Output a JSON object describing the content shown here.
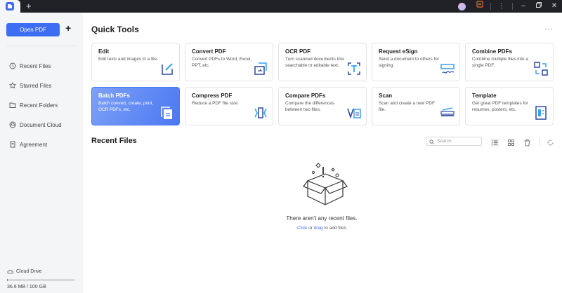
{
  "titlebar": {
    "new_tab": "+",
    "icons": [
      "avatar",
      "gift-icon",
      "more-vertical-icon",
      "minimize-icon",
      "restore-icon",
      "close-icon"
    ]
  },
  "sidebar": {
    "open_pdf": "Open PDF",
    "add": "+",
    "items": [
      {
        "label": "Recent Files",
        "icon": "clock-icon"
      },
      {
        "label": "Starred Files",
        "icon": "star-icon"
      },
      {
        "label": "Recent Folders",
        "icon": "folder-icon"
      },
      {
        "label": "Document Cloud",
        "icon": "cloud-icon"
      },
      {
        "label": "Agreement",
        "icon": "document-icon"
      }
    ],
    "cloud_drive": "Cloud Drive",
    "storage": "36.6 MB / 100 GB",
    "storage_fraction": 0.0004
  },
  "quick_tools": {
    "title": "Quick Tools",
    "more": "...",
    "cards": [
      {
        "title": "Edit",
        "desc": "Edit texts and images in a file.",
        "icon": "edit-icon"
      },
      {
        "title": "Convert PDF",
        "desc": "Convert PDFs to Word, Excel, PPT, etc.",
        "icon": "convert-icon"
      },
      {
        "title": "OCR PDF",
        "desc": "Turn scanned documents into searchable or editable text.",
        "icon": "ocr-icon"
      },
      {
        "title": "Request eSign",
        "desc": "Send a document to others for signing.",
        "icon": "esign-icon"
      },
      {
        "title": "Combine PDFs",
        "desc": "Combine multiple files into a single PDF.",
        "icon": "combine-icon"
      },
      {
        "title": "Batch PDFs",
        "desc": "Batch convert, create, print, OCR PDFs, etc.",
        "icon": "batch-icon"
      },
      {
        "title": "Compress PDF",
        "desc": "Reduce a PDF file size.",
        "icon": "compress-icon"
      },
      {
        "title": "Compare PDFs",
        "desc": "Compare the differences between two files.",
        "icon": "compare-icon"
      },
      {
        "title": "Scan",
        "desc": "Scan and create a new PDF file.",
        "icon": "scan-icon"
      },
      {
        "title": "Template",
        "desc": "Get great PDF templates for resumes, posters, etc.",
        "icon": "template-icon"
      }
    ]
  },
  "recent_files": {
    "title": "Recent Files",
    "search_placeholder": "Search",
    "empty_text": "There aren't any recent files.",
    "click": "Click",
    "or": " or ",
    "drag": "drag",
    "to_add": " to add files"
  }
}
